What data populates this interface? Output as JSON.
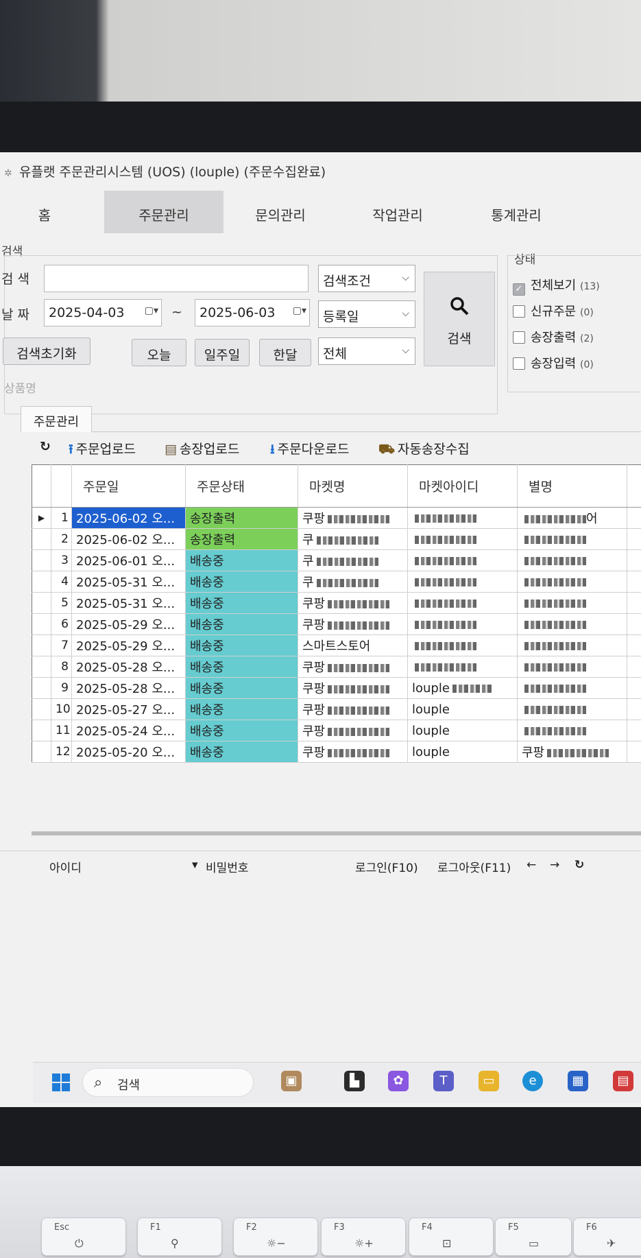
{
  "app": {
    "title": "유플랫 주문관리시스템 (UOS) (louple) (주문수집완료)"
  },
  "menu": {
    "tabs": [
      {
        "label": "홈"
      },
      {
        "label": "주문관리"
      },
      {
        "label": "문의관리"
      },
      {
        "label": "작업관리"
      },
      {
        "label": "통계관리"
      }
    ],
    "active": "주문관리"
  },
  "search": {
    "group_label": "검색",
    "search_label": "검 색",
    "search_value": "",
    "condition_select": "검색조건",
    "date_label": "날 짜",
    "date_from": "2025-04-03",
    "date_sep": "~",
    "date_to": "2025-06-03",
    "date_type_select": "등록일",
    "scope_select": "전체",
    "reset_button": "검색초기화",
    "today_button": "오늘",
    "week_button": "일주일",
    "month_button": "한달",
    "search_button": "검색",
    "product_name_label": "상품명"
  },
  "status": {
    "group_label": "상태",
    "items": [
      {
        "label": "전체보기",
        "count": "(13)",
        "checked": true
      },
      {
        "label": "신규주문",
        "count": "(0)",
        "checked": false
      },
      {
        "label": "송장출력",
        "count": "(2)",
        "checked": false
      },
      {
        "label": "송장입력",
        "count": "(0)",
        "checked": false
      }
    ]
  },
  "orders": {
    "tab_label": "주문관리",
    "toolbar": {
      "refresh_icon": "refresh-icon",
      "upload_orders": "주문업로드",
      "upload_invoices": "송장업로드",
      "download_orders": "주문다운로드",
      "auto_invoice": "자동송장수집"
    },
    "columns": [
      "주문일",
      "주문상태",
      "마켓명",
      "마켓아이디",
      "별명"
    ],
    "rows": [
      {
        "no": "1",
        "date": "2025-06-02 오...",
        "status": "송장출력",
        "market": "쿠팡",
        "market_id": "",
        "nick": "어"
      },
      {
        "no": "2",
        "date": "2025-06-02 오...",
        "status": "송장출력",
        "market": "쿠",
        "market_id": "",
        "nick": ""
      },
      {
        "no": "3",
        "date": "2025-06-01 오...",
        "status": "배송중",
        "market": "쿠",
        "market_id": "",
        "nick": ""
      },
      {
        "no": "4",
        "date": "2025-05-31 오...",
        "status": "배송중",
        "market": "쿠",
        "market_id": "",
        "nick": ""
      },
      {
        "no": "5",
        "date": "2025-05-31 오...",
        "status": "배송중",
        "market": "쿠팡",
        "market_id": "",
        "nick": ""
      },
      {
        "no": "6",
        "date": "2025-05-29 오...",
        "status": "배송중",
        "market": "쿠팡",
        "market_id": "",
        "nick": ""
      },
      {
        "no": "7",
        "date": "2025-05-29 오...",
        "status": "배송중",
        "market": "스마트스토어",
        "market_id": "",
        "nick": ""
      },
      {
        "no": "8",
        "date": "2025-05-28 오...",
        "status": "배송중",
        "market": "쿠팡",
        "market_id": "",
        "nick": ""
      },
      {
        "no": "9",
        "date": "2025-05-28 오...",
        "status": "배송중",
        "market": "쿠팡",
        "market_id": "louple",
        "nick": ""
      },
      {
        "no": "10",
        "date": "2025-05-27 오...",
        "status": "배송중",
        "market": "쿠팡",
        "market_id": "louple",
        "nick": ""
      },
      {
        "no": "11",
        "date": "2025-05-24 오...",
        "status": "배송중",
        "market": "쿠팡",
        "market_id": "louple",
        "nick": ""
      },
      {
        "no": "12",
        "date": "2025-05-20 오...",
        "status": "배송중",
        "market": "쿠팡",
        "market_id": "louple",
        "nick": "쿠팡"
      }
    ],
    "status_colors": {
      "송장출력": "#7cd05a",
      "배송중": "#66ccd0"
    },
    "selected_color": "#1d5fcf"
  },
  "login": {
    "id_label": "아이디",
    "pw_label": "비밀번호",
    "login_button": "로그인(F10)",
    "logout_button": "로그아웃(F11)",
    "back_icon": "←",
    "forward_icon": "→",
    "refresh_icon": "↻"
  },
  "taskbar": {
    "search_label": "검색"
  },
  "keyboard": {
    "keys": [
      {
        "label": "Esc"
      },
      {
        "label": "F1"
      },
      {
        "label": "F2"
      },
      {
        "label": "F3"
      },
      {
        "label": "F4"
      },
      {
        "label": "F5"
      },
      {
        "label": "F6"
      }
    ]
  }
}
